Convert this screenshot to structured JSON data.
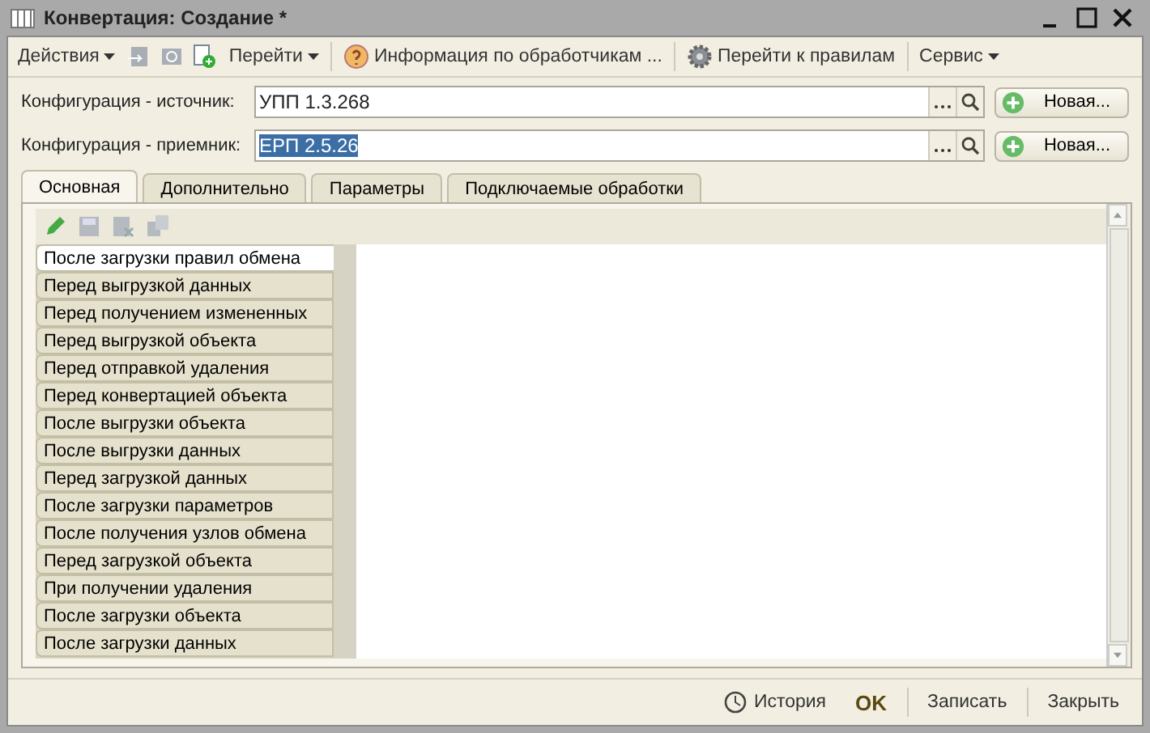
{
  "window": {
    "title": "Конвертация: Создание *"
  },
  "toolbar": [
    {
      "kind": "menu",
      "label": "Действия"
    },
    {
      "kind": "icon",
      "disabled": true
    },
    {
      "kind": "icon",
      "disabled": true
    },
    {
      "kind": "icon",
      "disabled": false
    },
    {
      "kind": "menu",
      "label": "Перейти"
    },
    {
      "kind": "sep"
    },
    {
      "kind": "button",
      "label": "Информация по обработчикам ..."
    },
    {
      "kind": "sep"
    },
    {
      "kind": "button",
      "label": "Перейти к правилам"
    },
    {
      "kind": "sep"
    },
    {
      "kind": "menu",
      "label": "Сервис"
    }
  ],
  "fields": [
    {
      "label": "Конфигурация - источник:",
      "value": "УПП 1.3.268",
      "highlighted": false,
      "button": "Новая..."
    },
    {
      "label": "Конфигурация - приемник:",
      "value": "ЕРП 2.5.26",
      "highlighted": true,
      "button": "Новая..."
    }
  ],
  "tabs": [
    {
      "label": "Основная",
      "selected": true
    },
    {
      "label": "Дополнительно",
      "selected": false
    },
    {
      "label": "Параметры",
      "selected": false
    },
    {
      "label": "Подключаемые обработки",
      "selected": false
    }
  ],
  "panel_tools": [
    {
      "disabled": false
    },
    {
      "disabled": true
    },
    {
      "disabled": true
    },
    {
      "disabled": true
    }
  ],
  "handlers": [
    {
      "label": "После загрузки правил обмена",
      "selected": true
    },
    {
      "label": "Перед выгрузкой данных",
      "selected": false
    },
    {
      "label": "Перед получением измененных",
      "selected": false
    },
    {
      "label": "Перед выгрузкой объекта",
      "selected": false
    },
    {
      "label": "Перед отправкой удаления",
      "selected": false
    },
    {
      "label": "Перед конвертацией объекта",
      "selected": false
    },
    {
      "label": "После выгрузки объекта",
      "selected": false
    },
    {
      "label": "После выгрузки данных",
      "selected": false
    },
    {
      "label": "Перед загрузкой данных",
      "selected": false
    },
    {
      "label": "После загрузки параметров",
      "selected": false
    },
    {
      "label": "После получения узлов обмена",
      "selected": false
    },
    {
      "label": "Перед загрузкой объекта",
      "selected": false
    },
    {
      "label": "При получении удаления",
      "selected": false
    },
    {
      "label": "После загрузки объекта",
      "selected": false
    },
    {
      "label": "После загрузки данных",
      "selected": false
    }
  ],
  "footer": [
    {
      "kind": "icon-link",
      "label": "История"
    },
    {
      "kind": "bold",
      "label": "OK"
    },
    {
      "kind": "link",
      "label": "Записать"
    },
    {
      "kind": "link",
      "label": "Закрыть"
    }
  ]
}
